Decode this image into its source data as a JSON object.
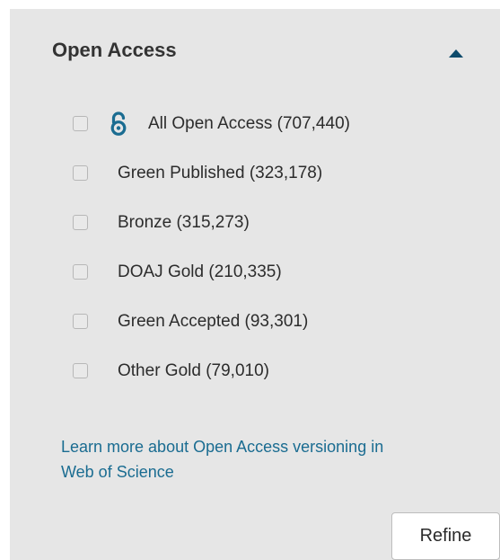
{
  "filter": {
    "title": "Open Access",
    "options": [
      {
        "label": "All Open Access (707,440)",
        "icon": "open-access-icon",
        "checked": false
      },
      {
        "label": "Green Published (323,178)",
        "checked": false
      },
      {
        "label": "Bronze (315,273)",
        "checked": false
      },
      {
        "label": "DOAJ Gold (210,335)",
        "checked": false
      },
      {
        "label": "Green Accepted (93,301)",
        "checked": false
      },
      {
        "label": "Other Gold (79,010)",
        "checked": false
      }
    ],
    "learn_more_link": "Learn more about Open Access versioning in Web of Science",
    "refine_label": "Refine"
  },
  "colors": {
    "panel_background": "#e6e6e6",
    "link": "#1a6c91",
    "accent": "#0d4a6b"
  }
}
